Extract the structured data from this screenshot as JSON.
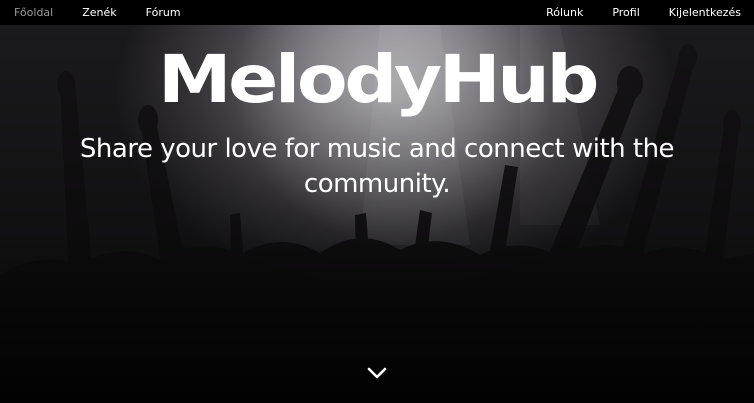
{
  "nav": {
    "left": [
      {
        "label": "Főoldal",
        "active": true
      },
      {
        "label": "Zenék",
        "active": false
      },
      {
        "label": "Fórum",
        "active": false
      }
    ],
    "right": [
      {
        "label": "Rólunk"
      },
      {
        "label": "Profil"
      },
      {
        "label": "Kijelentkezés"
      }
    ]
  },
  "hero": {
    "title": "MelodyHub",
    "subtitle": "Share your love for music and connect with the community.",
    "scroll_icon": "chevron-down-icon"
  },
  "colors": {
    "nav_bg": "#000000",
    "nav_text": "#ffffff",
    "nav_active": "#9a9a9a",
    "hero_text": "#ffffff"
  }
}
